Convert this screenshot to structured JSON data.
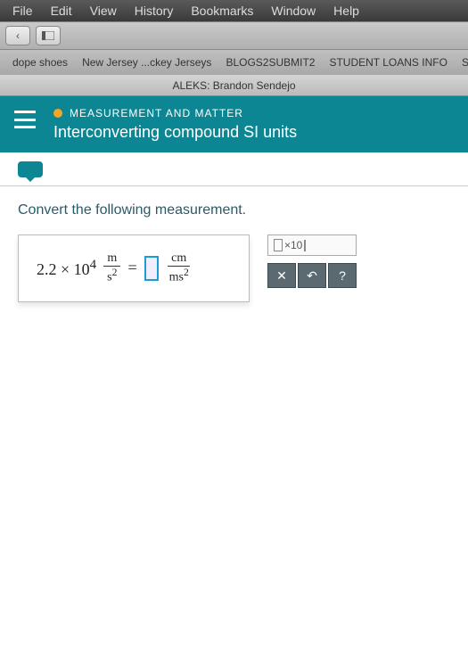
{
  "menubar": {
    "file": "File",
    "edit": "Edit",
    "view": "View",
    "history": "History",
    "bookmarks": "Bookmarks",
    "window": "Window",
    "help": "Help"
  },
  "toolbar": {
    "back": "‹"
  },
  "bookmarks": {
    "b1": "dope shoes",
    "b2": "New Jersey ...ckey Jerseys",
    "b3": "BLOGS2SUBMIT2",
    "b4": "STUDENT LOANS INFO",
    "b5": "STUDENT"
  },
  "page_title": "ALEKS: Brandon Sendejo",
  "header": {
    "category": "MEASUREMENT AND MATTER",
    "topic": "Interconverting compound SI units"
  },
  "prompt": "Convert the following measurement.",
  "equation": {
    "coef": "2.2 × 10",
    "exp": "4",
    "lhs_num": "m",
    "lhs_den_base": "s",
    "lhs_den_exp": "2",
    "equals": "=",
    "rhs_num": "cm",
    "rhs_den_base": "ms",
    "rhs_den_exp": "2"
  },
  "templates": {
    "sci": "×10"
  },
  "actions": {
    "clear": "✕",
    "undo": "↶",
    "help": "?"
  }
}
